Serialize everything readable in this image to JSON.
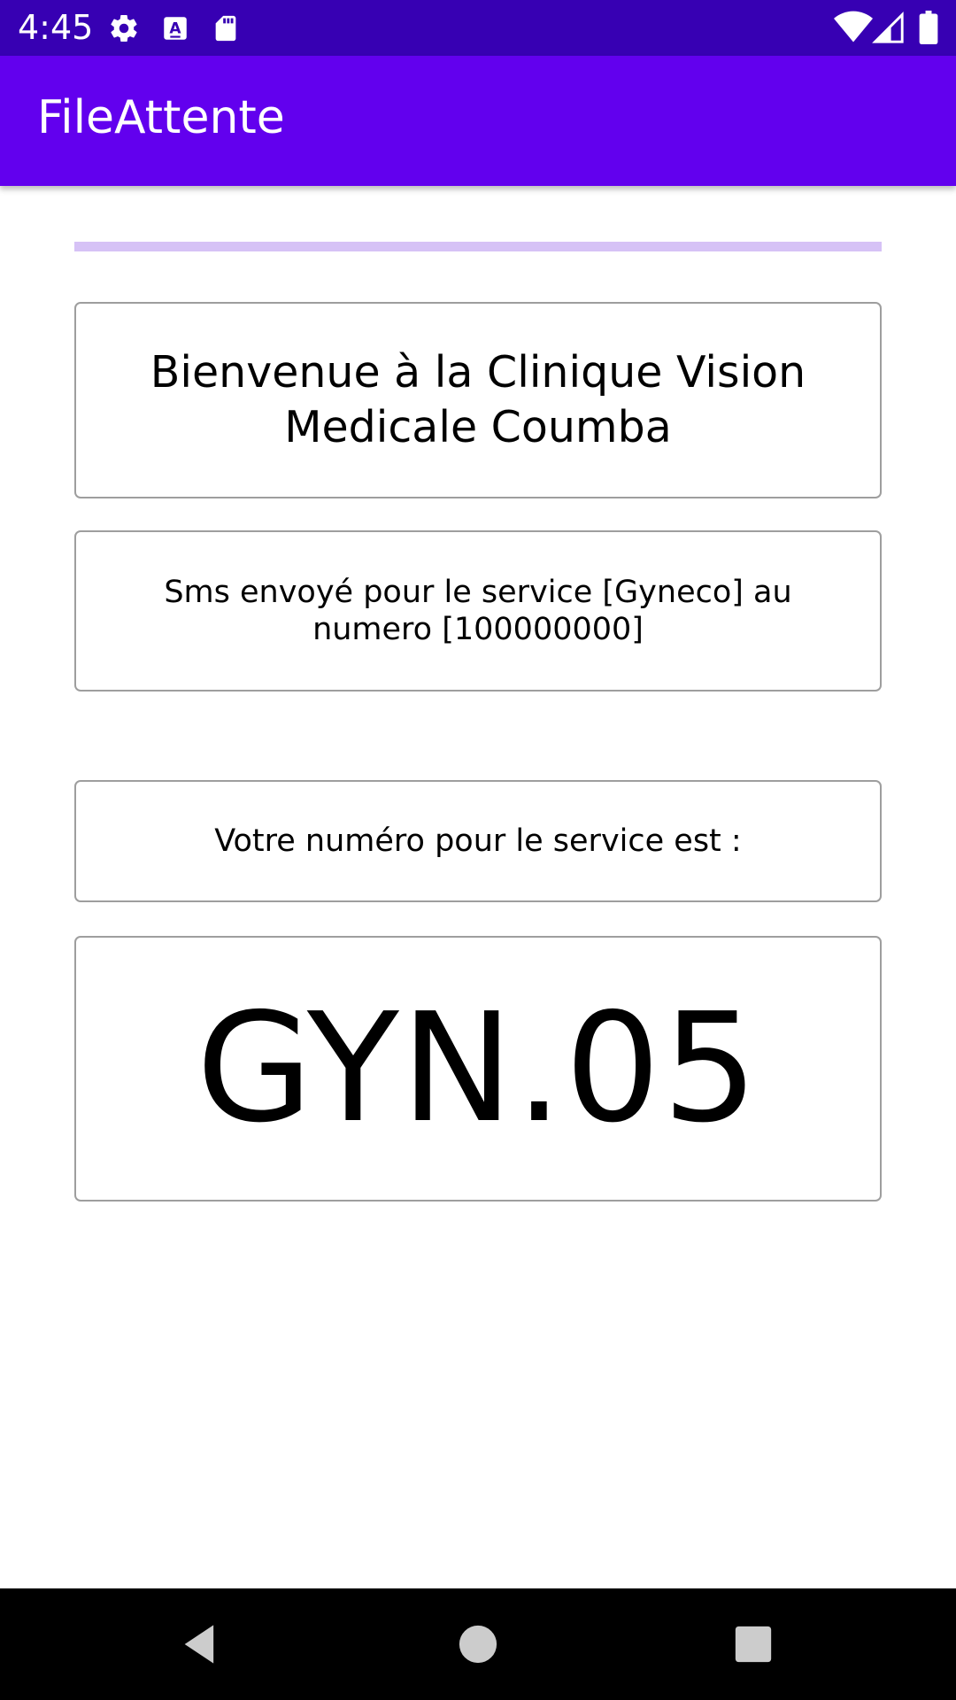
{
  "status_bar": {
    "time": "4:45",
    "icons_left": [
      "gear-icon",
      "a-text-icon",
      "sd-card-icon"
    ],
    "icons_right": [
      "wifi-icon",
      "signal-icon",
      "battery-icon"
    ]
  },
  "app_bar": {
    "title": "FileAttente"
  },
  "progress": {
    "value": 0
  },
  "content": {
    "welcome": "Bienvenue à la Clinique Vision Medicale Coumba",
    "sms_message": "Sms envoyé pour le service [Gyneco] au numero [100000000]",
    "number_label": "Votre numéro pour le service est :",
    "ticket_number": "GYN.05"
  },
  "nav_bar": {
    "buttons": [
      "back-icon",
      "home-icon",
      "recents-icon"
    ]
  },
  "colors": {
    "status_bar": "#3700b3",
    "app_bar": "#6200ee",
    "progress_track": "#d6c2f6"
  }
}
